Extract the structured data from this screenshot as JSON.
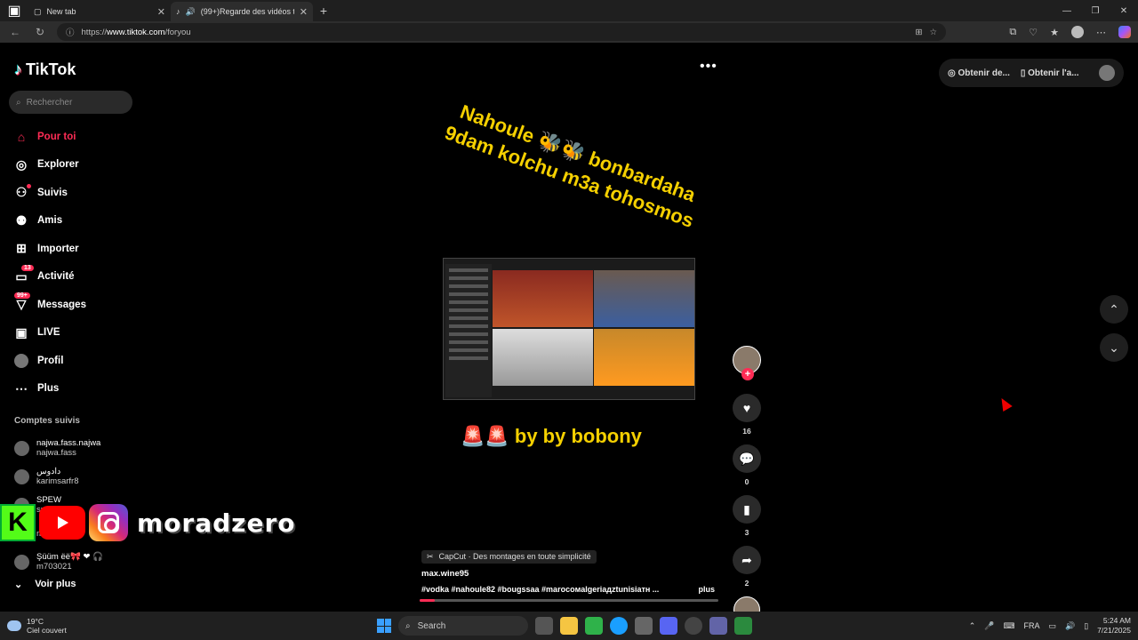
{
  "browser": {
    "tabs": [
      {
        "title": "New tab"
      },
      {
        "title": "(99+)Regarde des vidéos te"
      }
    ],
    "new_tab": "+",
    "url_scheme": "https://",
    "url_host": "www.tiktok.com",
    "url_path": "/foryou"
  },
  "tiktok": {
    "logo": "TikTok",
    "search_placeholder": "Rechercher",
    "nav": [
      {
        "label": "Pour toi",
        "icon": "home-icon"
      },
      {
        "label": "Explorer",
        "icon": "compass-icon"
      },
      {
        "label": "Suivis",
        "icon": "following-icon"
      },
      {
        "label": "Amis",
        "icon": "friends-icon"
      },
      {
        "label": "Importer",
        "icon": "upload-icon"
      },
      {
        "label": "Activité",
        "icon": "activity-icon",
        "badge": "13"
      },
      {
        "label": "Messages",
        "icon": "messages-icon",
        "badge": "99+"
      },
      {
        "label": "LIVE",
        "icon": "live-icon"
      },
      {
        "label": "Profil",
        "icon": "profile-icon"
      },
      {
        "label": "Plus",
        "icon": "more-icon"
      }
    ],
    "followed_title": "Comptes suivis",
    "followed": [
      {
        "name": "najwa.fass.najwa",
        "user": "najwa.fass"
      },
      {
        "name": "دادوس",
        "user": "karimsarfr8"
      },
      {
        "name": "SPEW",
        "user": "sp..."
      },
      {
        "name": "",
        "user": "m..."
      },
      {
        "name": "Şüüm ëë🎀 ❤ 🎧",
        "user": "m703021"
      }
    ],
    "see_more": "Voir plus",
    "top_right": {
      "get_coins": "Obtenir de...",
      "get_app": "Obtenir l'a..."
    }
  },
  "overlay": {
    "kick_letter": "K",
    "streamer_name": "moradzero"
  },
  "video": {
    "text_top": "Nahoule 🐝🐝 bonbardaha 9dam kolchu m3a tohosmos",
    "text_bottom": "🚨🚨 by by bobony",
    "capcut": "CapCut · Des montages en toute simplicité",
    "author": "max.wine95",
    "tags": "#vodka  #nahoule82  #bougssaa  #marocoмalgeriaдztunisiaтн ...",
    "more": "plus",
    "progress": 0.05,
    "likes": "16",
    "comments": "0",
    "saves": "3",
    "shares": "2"
  },
  "taskbar": {
    "temp": "19°C",
    "weather": "Ciel couvert",
    "search": "Search",
    "lang": "FRA",
    "time": "5:24 AM",
    "date": "7/21/2025"
  }
}
